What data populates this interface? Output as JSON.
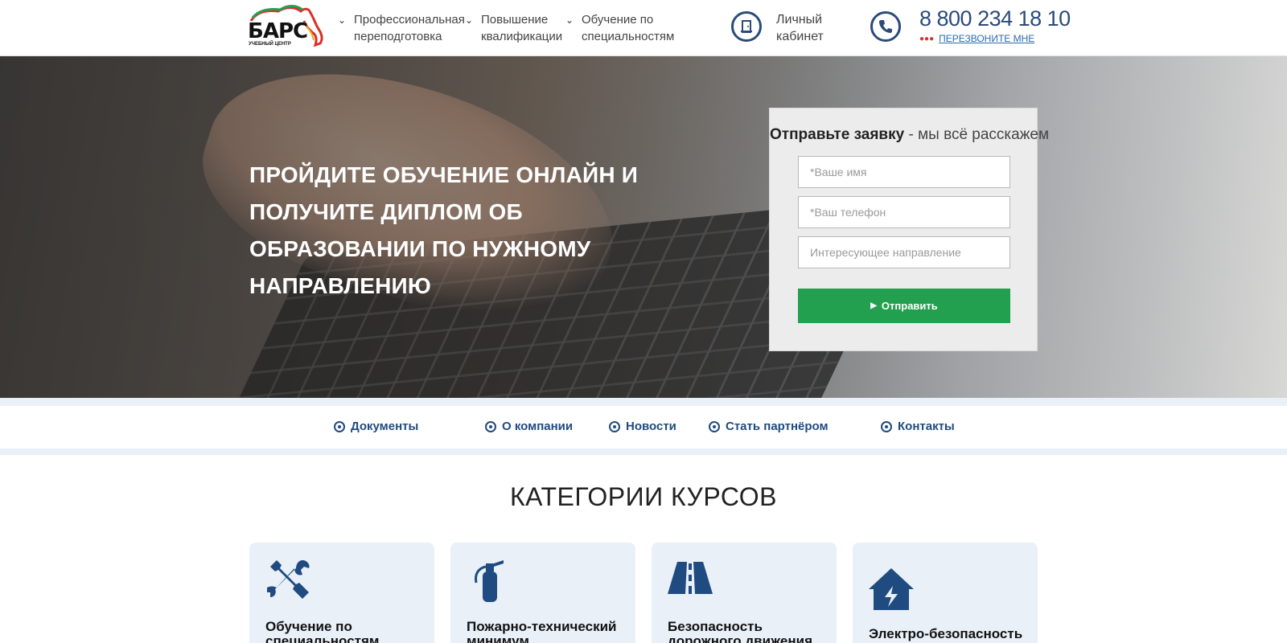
{
  "header": {
    "logo": {
      "text": "БАРС",
      "sub": "УЧЕБНЫЙ ЦЕНТР"
    },
    "nav": [
      {
        "line1": "Профессиональная",
        "line2": "переподготовка"
      },
      {
        "line1": "Повышение",
        "line2": "квалификации"
      },
      {
        "line1": "Обучение по",
        "line2": "специальностям"
      }
    ],
    "cabinet": {
      "line1": "Личный",
      "line2": "кабинет"
    },
    "phone": "8 800 234 18 10",
    "callback": "ПЕРЕЗВОНИТЕ МНЕ"
  },
  "hero": {
    "title_lines": [
      "ПРОЙДИТЕ ОБУЧЕНИЕ ОНЛАЙН И",
      "ПОЛУЧИТЕ ДИПЛОМ ОБ",
      "ОБРАЗОВАНИИ ПО НУЖНОМУ",
      "НАПРАВЛЕНИЮ"
    ]
  },
  "form": {
    "title_bold": "Отправьте заявку",
    "title_rest": " - мы всё расскажем",
    "name_placeholder": "*Ваше имя",
    "phone_placeholder": "*Ваш телефон",
    "direction_placeholder": "Интересующее направление",
    "submit_label": "Отправить"
  },
  "subnav": [
    "Документы",
    "О компании",
    "Новости",
    "Стать партнёром",
    "Контакты"
  ],
  "categories": {
    "title": "КАТЕГОРИИ КУРСОВ",
    "items": [
      {
        "line1": "Обучение по",
        "line2": "специальностям",
        "icon": "tools-icon"
      },
      {
        "line1": "Пожарно-технический",
        "line2": "минимум",
        "icon": "fire-extinguisher-icon"
      },
      {
        "line1": "Безопасность",
        "line2": "дорожного движения",
        "icon": "road-icon"
      },
      {
        "line1": "Электро-безопасность",
        "line2": "",
        "icon": "electric-house-icon"
      }
    ]
  },
  "colors": {
    "brand_blue": "#1f4b80",
    "accent_green": "#23a04f",
    "accent_red": "#d9302b"
  }
}
